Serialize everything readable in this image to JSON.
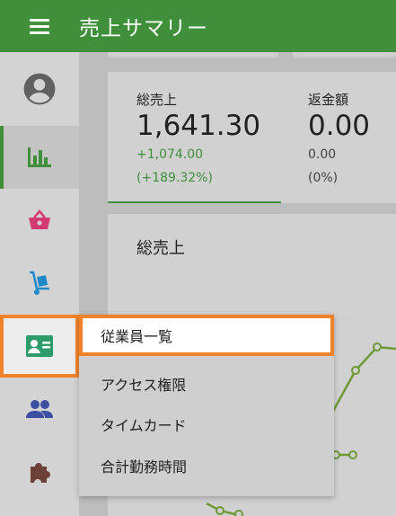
{
  "header": {
    "title": "売上サマリー",
    "menu_icon": "hamburger-menu-icon",
    "background_color": "#3f8f3b"
  },
  "sidebar": {
    "items": [
      {
        "icon": "account-circle-icon",
        "color": "#616161"
      },
      {
        "icon": "bar-chart-icon",
        "color": "#3f8f3b",
        "active": true
      },
      {
        "icon": "shopping-basket-icon",
        "color": "#d43a72"
      },
      {
        "icon": "hand-truck-icon",
        "color": "#1e88c8"
      },
      {
        "icon": "employee-badge-icon",
        "color": "#2e9c6a",
        "highlighted": true
      },
      {
        "icon": "people-icon",
        "color": "#3d4fa0"
      },
      {
        "icon": "puzzle-piece-icon",
        "color": "#6d4038"
      }
    ]
  },
  "stats": {
    "gross_sales": {
      "label": "総売上",
      "value": "1,641.30",
      "delta": "+1,074.00",
      "delta_percent": "(+189.32%)",
      "delta_color": "#3f8f3b"
    },
    "refunds": {
      "label": "返金額",
      "value": "0.00",
      "delta": "0.00",
      "delta_percent": "(0%)"
    }
  },
  "chart": {
    "title": "総売上",
    "line_color": "#6d9a35"
  },
  "dropdown": {
    "items": [
      {
        "label": "従業員一覧",
        "selected": true
      },
      {
        "label": "アクセス権限"
      },
      {
        "label": "タイムカード"
      },
      {
        "label": "合計勤務時間"
      }
    ],
    "highlight_color": "#f0832a"
  }
}
